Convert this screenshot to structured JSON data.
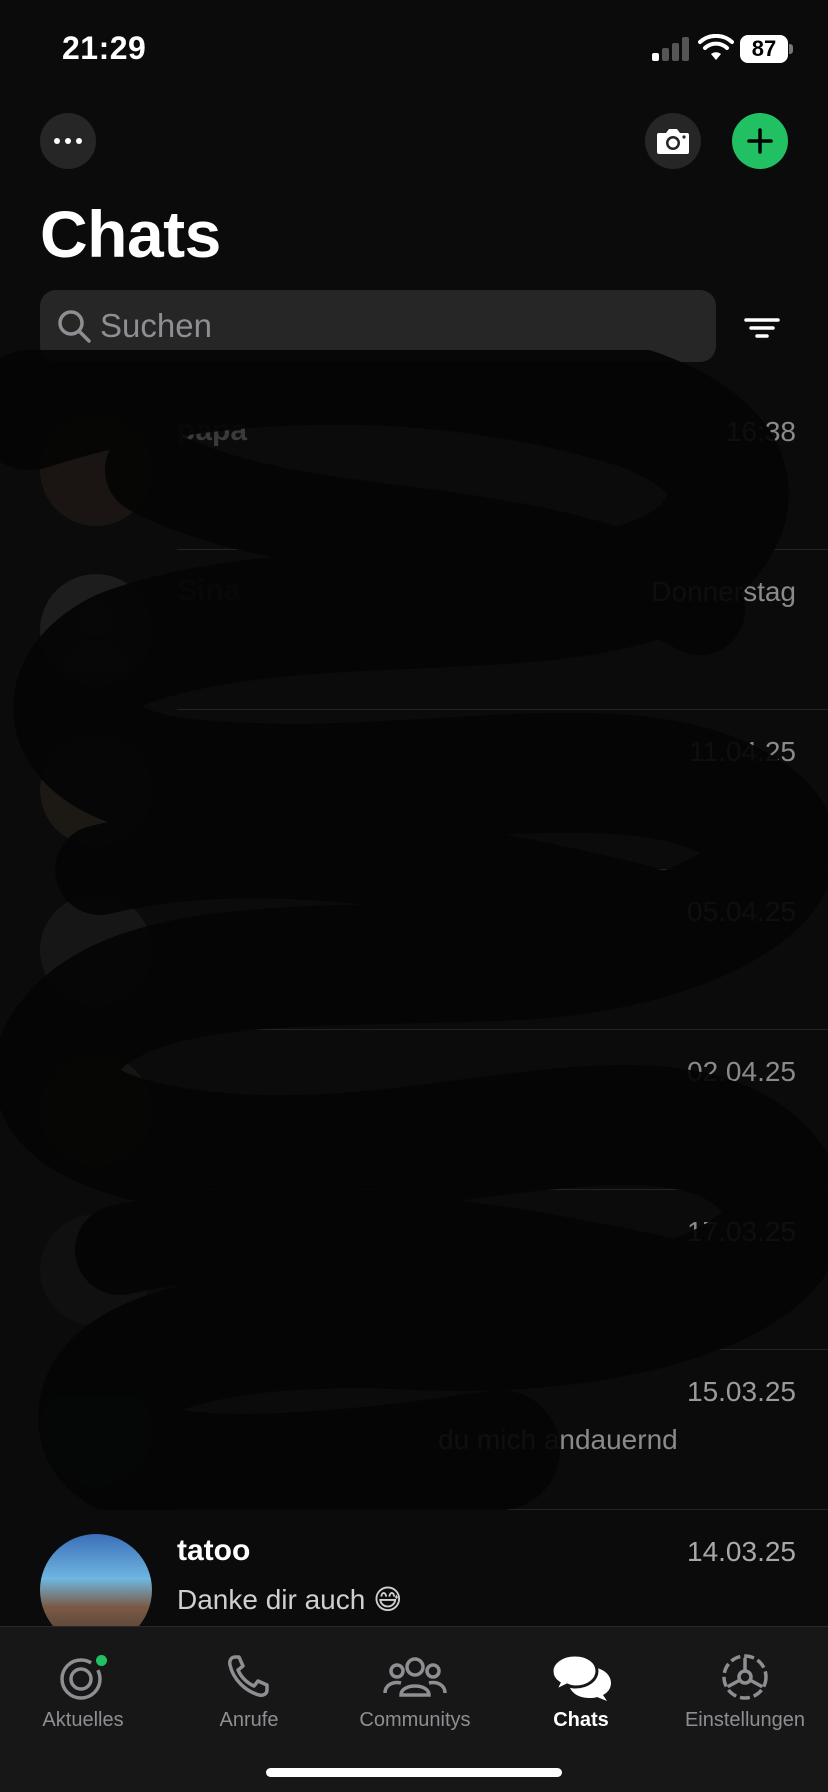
{
  "status_bar": {
    "time": "21:29",
    "battery_level": "87"
  },
  "header": {
    "title": "Chats"
  },
  "search": {
    "placeholder": "Suchen"
  },
  "colors": {
    "accent": "#21c063",
    "background": "#0b0b0b",
    "surface": "#262626",
    "tab_bar": "#171717"
  },
  "chats": [
    {
      "name": "papa",
      "time": "16:38",
      "preview": ""
    },
    {
      "name": "Sina",
      "time": "Donnerstag",
      "preview": ""
    },
    {
      "name": "",
      "time": "11.04.25",
      "preview": ""
    },
    {
      "name": "",
      "time": "05.04.25",
      "preview": ""
    },
    {
      "name": "",
      "time": "02.04.25",
      "preview": ""
    },
    {
      "name": "",
      "time": "17.03.25",
      "preview": ""
    },
    {
      "name": "",
      "time": "15.03.25",
      "preview": "du mich andauernd"
    },
    {
      "name": "tatoo",
      "time": "14.03.25",
      "preview": "Danke dir auch 😅"
    }
  ],
  "tabs": [
    {
      "label": "Aktuelles",
      "icon": "status-icon",
      "active": false
    },
    {
      "label": "Anrufe",
      "icon": "phone-icon",
      "active": false
    },
    {
      "label": "Communitys",
      "icon": "communities-icon",
      "active": false
    },
    {
      "label": "Chats",
      "icon": "chats-icon",
      "active": true
    },
    {
      "label": "Einstellungen",
      "icon": "settings-icon",
      "active": false
    }
  ]
}
